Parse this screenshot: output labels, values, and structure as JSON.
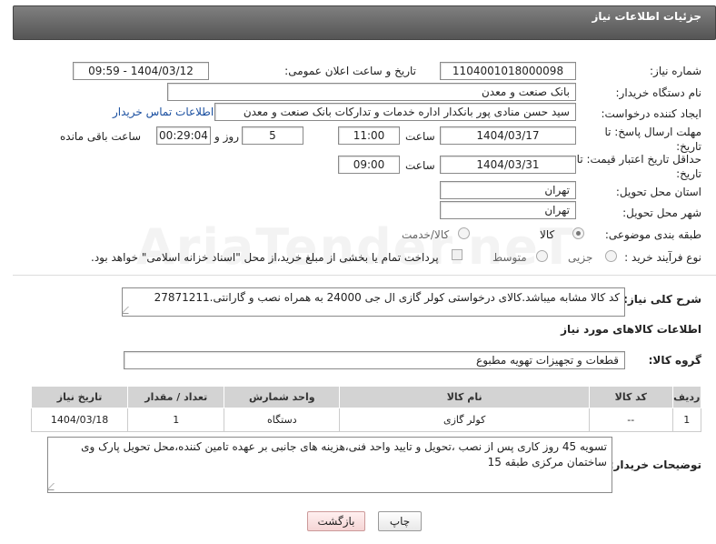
{
  "header": {
    "title": "جزئیات اطلاعات نیاز"
  },
  "fields": {
    "need_number_label": "شماره نیاز:",
    "need_number": "1104001018000098",
    "announce_label": "تاریخ و ساعت اعلان عمومی:",
    "announce_value": "1404/03/12 - 09:59",
    "buyer_org_label": "نام دستگاه خریدار:",
    "buyer_org": "بانک صنعت و معدن",
    "creator_label": "ایجاد کننده درخواست:",
    "creator": "سید حسن منادی پور بانکدار اداره خدمات و تدارکات بانک صنعت و معدن",
    "contact_link": "اطلاعات تماس خریدار",
    "deadline_label": "مهلت ارسال پاسخ: تا تاریخ:",
    "deadline_date": "1404/03/17",
    "time_label": "ساعت",
    "deadline_time": "11:00",
    "days_value": "5",
    "days_label": "روز و",
    "remaining_value": "00:29:04",
    "remaining_label": "ساعت باقی مانده",
    "price_valid_label": "حداقل تاریخ اعتبار قیمت: تا تاریخ:",
    "price_valid_date": "1404/03/31",
    "price_valid_time": "09:00",
    "province_label": "استان محل تحویل:",
    "province": "تهران",
    "city_label": "شهر محل تحویل:",
    "city": "تهران",
    "category_label": "طبقه بندی موضوعی:",
    "category_goods": "کالا",
    "category_goods_service": "کالا/خدمت",
    "process_label": "نوع فرآیند خرید :",
    "process_partial": "جزیی",
    "process_medium": "متوسط",
    "payment_note": "پرداخت تمام یا بخشی از مبلغ خرید،از محل \"اسناد خزانه اسلامی\" خواهد بود."
  },
  "description": {
    "label": "شرح کلی نیاز:",
    "text": "کد کالا مشابه میباشد.کالای درخواستی کولر گازی ال جی 24000 به همراه نصب و گارانتی.27871211"
  },
  "goods_info": {
    "title": "اطلاعات کالاهای مورد نیاز",
    "group_label": "گروه کالا:",
    "group_value": "قطعات و تجهیزات تهویه مطبوع"
  },
  "table": {
    "headers": [
      "ردیف",
      "کد کالا",
      "نام کالا",
      "واحد شمارش",
      "تعداد / مقدار",
      "تاریخ نیاز"
    ],
    "rows": [
      [
        "1",
        "--",
        "کولر گازی",
        "دستگاه",
        "1",
        "1404/03/18"
      ]
    ]
  },
  "buyer_notes": {
    "label": "توضیحات خریدار:",
    "text": "تسویه 45 روز کاری پس از نصب ،تحویل و تایید واحد فنی،هزینه های جانبی بر عهده تامین کننده،محل تحویل پارک وی ساختمان مرکزی طبقه 15"
  },
  "buttons": {
    "print": "چاپ",
    "back": "بازگشت"
  },
  "watermark": "AriaTender.neT"
}
